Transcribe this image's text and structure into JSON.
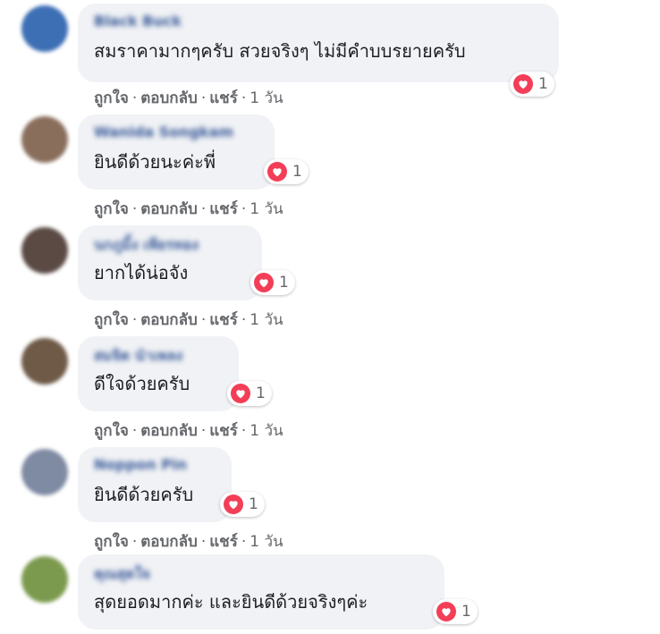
{
  "comments": [
    {
      "name": "Black Buck",
      "text": "สมราคามากๆครับ สวยจริงๆ ไม่มีคำบบรยายครับ",
      "reactions": "1",
      "time": "1 วัน",
      "avatar_color": "#3d6fb5"
    },
    {
      "name": "Wanida Songkam",
      "text": "ยินดีด้วยนะค่ะพี่",
      "reactions": "1",
      "time": "1 วัน",
      "avatar_color": "#8a6e5c"
    },
    {
      "name": "นกภูมิ้ง เพียรทอง",
      "text": "ยากได้น่อจัง",
      "reactions": "1",
      "time": "1 วัน",
      "avatar_color": "#5b4a44"
    },
    {
      "name": "สมจิต นำเพลง",
      "text": "ดีใจด้วยครับ",
      "reactions": "1",
      "time": "1 วัน",
      "avatar_color": "#6f5a48"
    },
    {
      "name": "Noppon Pin",
      "text": "ยินดีด้วยครับ",
      "reactions": "1",
      "time": "1 วัน",
      "avatar_color": "#7f8aa3"
    },
    {
      "name": "คุณสุดใจ",
      "text": "สุดยอดมากค่ะ และยินดีด้วยจริงๆค่ะ",
      "reactions": "1",
      "time": "1 วัน",
      "avatar_color": "#7c9a4e"
    }
  ],
  "actions": {
    "like": "ถูกใจ",
    "reply": "ตอบกลับ",
    "share": "แชร์",
    "separator": "·"
  },
  "colors": {
    "heart": "#f33e58",
    "bubble": "#f0f2f5",
    "action_text": "#65676b"
  }
}
